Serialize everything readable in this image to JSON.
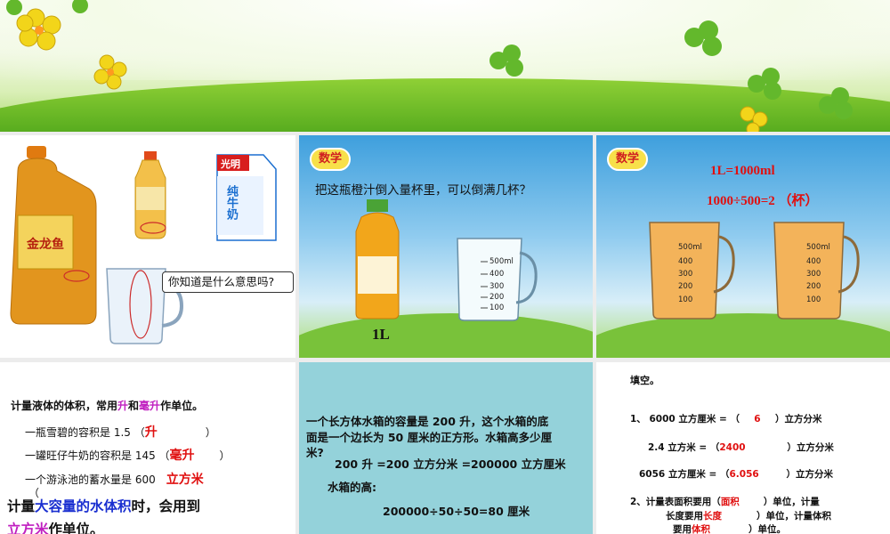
{
  "panel1": {
    "oil_label": "金龙鱼",
    "milk_brand": "光明",
    "milk_text": "纯牛奶",
    "bubble": "你知道是什么意思吗?"
  },
  "panel2": {
    "badge": "数学",
    "question": "把这瓶橙汁倒入量杯里，可以倒满几杯？",
    "bottle_label": "1L",
    "cup_scale": [
      "500ml",
      "400",
      "300",
      "200",
      "100"
    ]
  },
  "panel3": {
    "badge": "数学",
    "line1": "1L=1000ml",
    "line2": "1000÷500=2 （杯）",
    "cup_scale": [
      "500ml",
      "400",
      "300",
      "200",
      "100"
    ]
  },
  "panel4": {
    "intro_a": "计量液体的体积，常用",
    "intro_sheng": "升",
    "intro_he": "和",
    "intro_haosheng": "毫升",
    "intro_b": "作单位。",
    "l1": "一瓶雪碧的容积是 1.5 （",
    "l1_ans": "升",
    "l1_end": "）",
    "l2": "一罐旺仔牛奶的容积是 145 （",
    "l2_ans": "毫升",
    "l2_end": "）",
    "l3": "一个游泳池的蓄水量是 600",
    "l3_ans": "立方米",
    "l3_paren": "（",
    "big_a": "计量",
    "big_b": "大容量的水体积",
    "big_c": "时，会用到",
    "big_d": "立方米",
    "big_e": "作单位。"
  },
  "panel5": {
    "p1": "一个长方体水箱的容量是 200 升，这个水箱的底",
    "p2": "面是一个边长为 50 厘米的正方形。水箱高多少厘",
    "p3": "米?",
    "eq1": "200 升 =200 立方分米 =200000 立方厘米",
    "eq2": "水箱的高:",
    "eq3": "200000÷50÷50=80 厘米"
  },
  "panel6": {
    "title": "填空。",
    "q1a": "1、 6000 立方厘米 = （",
    "q1ans": "6",
    "q1b": "）立方分米",
    "q2a": "2.4 立方米 = （",
    "q2ans": "2400",
    "q2b": "）立方分米",
    "q3a": "6056 立方厘米 = （",
    "q3ans": "6.056",
    "q3b": "）立方分米",
    "q4a": "2、计量表面积要用（",
    "q4ans": "面积",
    "q4b": "）单位，计量",
    "q5a": "长度要用",
    "q5ans": "长度",
    "q5b": "）单位，计量体积",
    "q6a": "要用",
    "q6ans": "体积",
    "q6b": "）单位。"
  },
  "colors": {
    "red": "#e01010",
    "magenta": "#c020c0",
    "blue": "#1a2fd0",
    "teal_panel": "#94d2da"
  }
}
